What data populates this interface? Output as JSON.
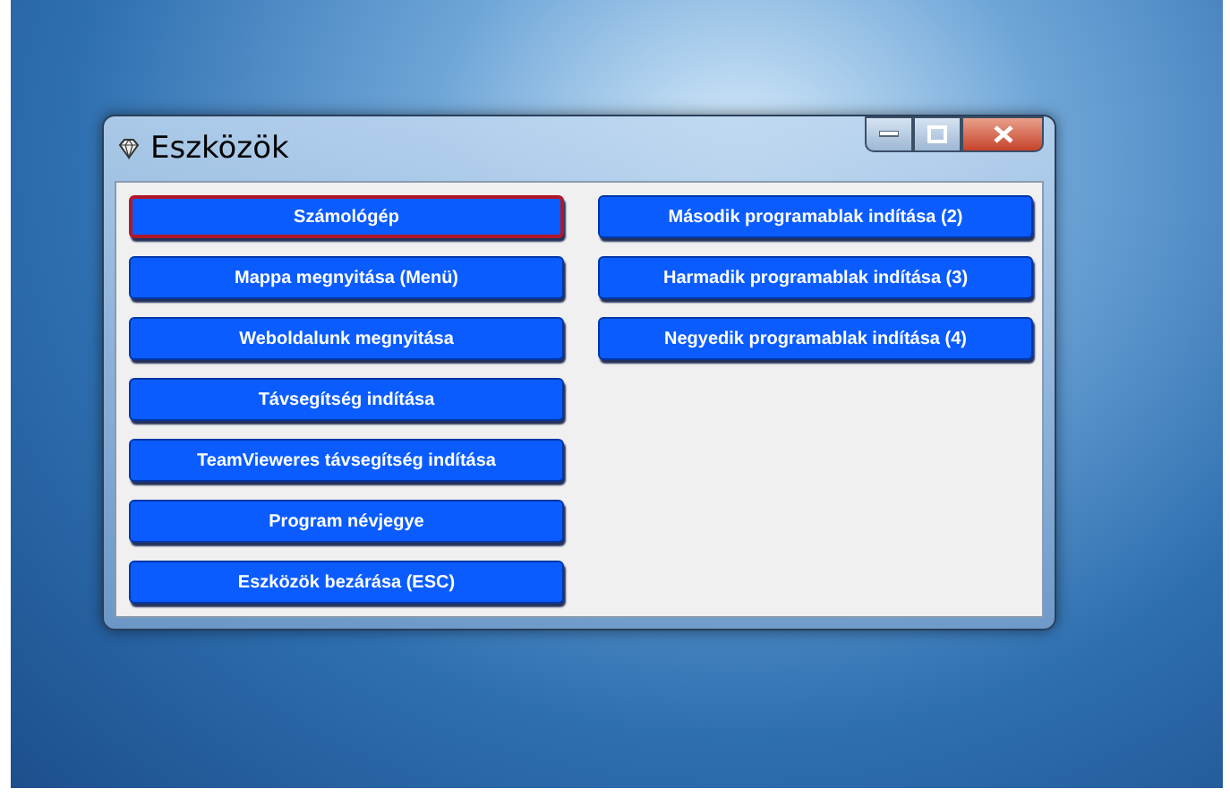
{
  "window": {
    "title": "Eszközök"
  },
  "left_buttons": [
    {
      "label": "Számológép",
      "focused": true
    },
    {
      "label": "Mappa megnyitása (Menü)",
      "focused": false
    },
    {
      "label": "Weboldalunk megnyitása",
      "focused": false
    },
    {
      "label": "Távsegítség indítása",
      "focused": false
    },
    {
      "label": "TeamVieweres távsegítség indítása",
      "focused": false
    },
    {
      "label": "Program névjegye",
      "focused": false
    },
    {
      "label": "Eszközök bezárása (ESC)",
      "focused": false
    }
  ],
  "right_buttons": [
    {
      "label": "Második programablak indítása (2)",
      "focused": false
    },
    {
      "label": "Harmadik programablak indítása (3)",
      "focused": false
    },
    {
      "label": "Negyedik programablak indítása (4)",
      "focused": false
    }
  ]
}
